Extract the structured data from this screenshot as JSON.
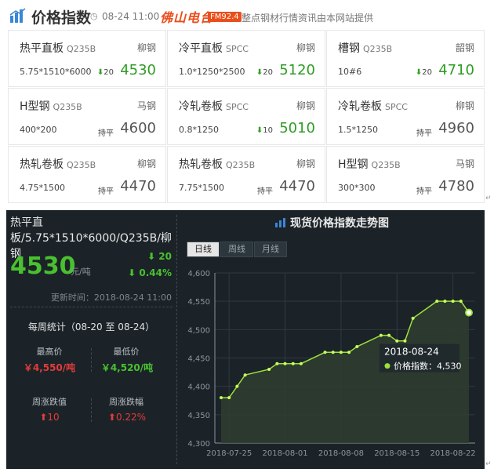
{
  "header": {
    "title": "价格指数",
    "datetime": "08-24 11:00",
    "brand": "佛山电台",
    "fm": "FM92.4",
    "note": "整点钢材行情资讯由本网站提供"
  },
  "products": [
    {
      "name": "热平直板",
      "grade": "Q235B",
      "mill": "柳钢",
      "spec": "5.75*1510*6000",
      "change_dir": "down",
      "change": "20",
      "price": "4530"
    },
    {
      "name": "冷平直板",
      "grade": "SPCC",
      "mill": "柳钢",
      "spec": "1.0*1250*2500",
      "change_dir": "down",
      "change": "20",
      "price": "5120"
    },
    {
      "name": "槽钢",
      "grade": "Q235B",
      "mill": "韶钢",
      "spec": "10#6",
      "change_dir": "down",
      "change": "20",
      "price": "4710"
    },
    {
      "name": "H型钢",
      "grade": "Q235B",
      "mill": "马钢",
      "spec": "400*200",
      "change_dir": "flat",
      "change": "持平",
      "price": "4600"
    },
    {
      "name": "冷轧卷板",
      "grade": "SPCC",
      "mill": "柳钢",
      "spec": "0.8*1250",
      "change_dir": "down",
      "change": "10",
      "price": "5010"
    },
    {
      "name": "冷轧卷板",
      "grade": "SPCC",
      "mill": "柳钢",
      "spec": "1.5*1250",
      "change_dir": "flat",
      "change": "持平",
      "price": "4960"
    },
    {
      "name": "热轧卷板",
      "grade": "Q235B",
      "mill": "柳钢",
      "spec": "4.75*1500",
      "change_dir": "flat",
      "change": "持平",
      "price": "4470"
    },
    {
      "name": "热轧卷板",
      "grade": "Q235B",
      "mill": "柳钢",
      "spec": "7.75*1500",
      "change_dir": "flat",
      "change": "持平",
      "price": "4470"
    },
    {
      "name": "H型钢",
      "grade": "Q235B",
      "mill": "马钢",
      "spec": "300*300",
      "change_dir": "flat",
      "change": "持平",
      "price": "4780"
    }
  ],
  "detail": {
    "title": "热平直板/5.75*1510*6000/Q235B/柳钢",
    "price": "4530",
    "unit": "元/吨",
    "change_abs": "⬇ 20",
    "change_pct": "⬇ 0.44%",
    "updated": "更新时间：2018-08-24 11:00",
    "weekly_title": "每周统计（08-20 至 08-24）",
    "high_label": "最高价",
    "high_value": "￥4,550/吨",
    "low_label": "最低价",
    "low_value": "￥4,520/吨",
    "wk_change_label": "周涨跌值",
    "wk_change_value": "⬆10",
    "wk_pct_label": "周涨跌幅",
    "wk_pct_value": "⬆0.22%"
  },
  "chart_panel": {
    "title": "现货价格指数走势图",
    "tabs": [
      "日线",
      "周线",
      "月线"
    ],
    "active_tab": 0,
    "tooltip_date": "2018-08-24",
    "tooltip_label": "价格指数：4,530"
  },
  "chart_data": {
    "type": "area",
    "x": [
      "2018-07-24",
      "2018-07-25",
      "2018-07-26",
      "2018-07-27",
      "2018-07-30",
      "2018-07-31",
      "2018-08-01",
      "2018-08-02",
      "2018-08-03",
      "2018-08-06",
      "2018-08-07",
      "2018-08-08",
      "2018-08-09",
      "2018-08-10",
      "2018-08-13",
      "2018-08-14",
      "2018-08-15",
      "2018-08-16",
      "2018-08-17",
      "2018-08-20",
      "2018-08-21",
      "2018-08-22",
      "2018-08-23",
      "2018-08-24"
    ],
    "values": [
      4380,
      4380,
      4400,
      4420,
      4430,
      4440,
      4440,
      4440,
      4440,
      4460,
      4460,
      4460,
      4460,
      4470,
      4490,
      4490,
      4480,
      4480,
      4520,
      4550,
      4550,
      4550,
      4550,
      4530
    ],
    "xticks": [
      "2018-07-25",
      "2018-08-01",
      "2018-08-08",
      "2018-08-15",
      "2018-08-22"
    ],
    "yticks": [
      "4,300",
      "4,350",
      "4,400",
      "4,450",
      "4,500",
      "4,550",
      "4,600"
    ],
    "ylim": [
      4300,
      4600
    ],
    "grid": true,
    "colors": {
      "line": "#9be03a",
      "point": "#c9ff5a",
      "area": "#2f3d2f",
      "axis": "#8a969c",
      "grid": "#2e3a40"
    }
  },
  "colors": {
    "down": "#2e9c24",
    "red": "#e23b3b",
    "green": "#49c12f",
    "panel": "#1b2328"
  }
}
